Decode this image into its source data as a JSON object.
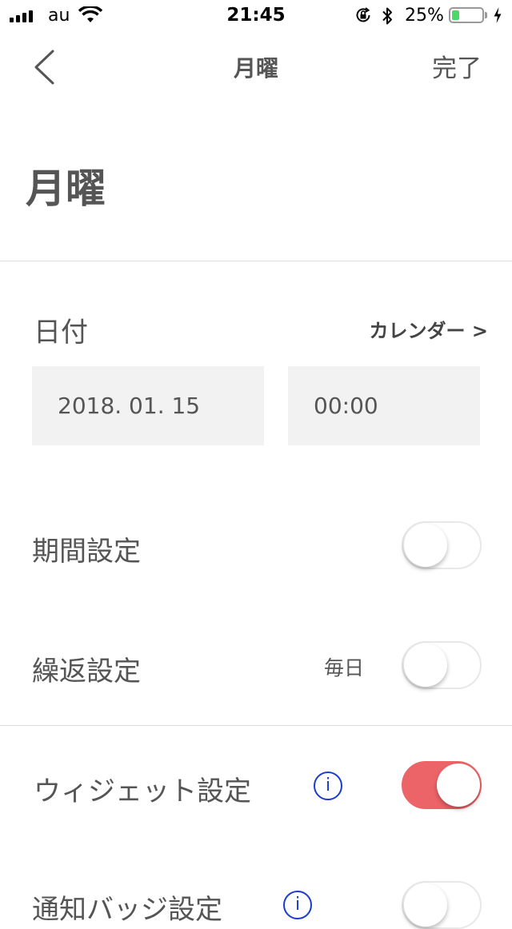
{
  "status_bar": {
    "carrier": "au",
    "time": "21:45",
    "battery_percent": "25%",
    "battery_level": 0.25,
    "icons": [
      "signal-icon",
      "wifi-icon",
      "rotation-lock-icon",
      "bluetooth-icon",
      "battery-icon",
      "charging-icon"
    ]
  },
  "nav": {
    "title": "月曜",
    "done_label": "完了",
    "back_icon": "chevron-left-icon"
  },
  "page_title": "月曜",
  "date_section": {
    "label": "日付",
    "calendar_link": "カレンダー >",
    "date_value": "2018. 01. 15",
    "time_value": "00:00"
  },
  "settings": {
    "period": {
      "label": "期間設定",
      "enabled": false
    },
    "repeat": {
      "label": "繰返設定",
      "value": "毎日",
      "enabled": false
    },
    "widget": {
      "label": "ウィジェット設定",
      "info_glyph": "i",
      "enabled": true
    },
    "badge": {
      "label": "通知バッジ設定",
      "info_glyph": "i",
      "enabled": false
    }
  },
  "colors": {
    "accent_toggle_on": "#ec6468",
    "info_icon": "#1a3ccf",
    "field_background": "#f2f2f2",
    "battery_fill": "#4cd964"
  }
}
